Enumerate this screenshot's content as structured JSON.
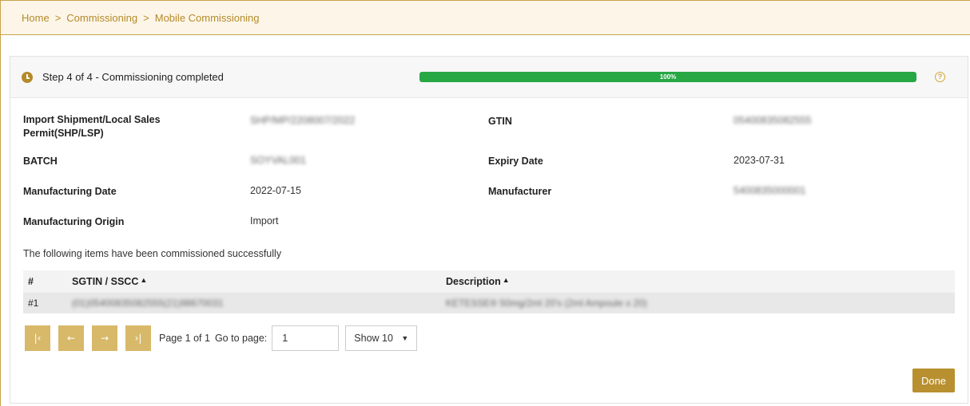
{
  "breadcrumb": {
    "items": [
      "Home",
      "Commissioning",
      "Mobile Commissioning"
    ],
    "separator": ">"
  },
  "step": {
    "title": "Step 4 of 4 - Commissioning completed",
    "progress_label": "100%",
    "progress_value": 1.0,
    "help_icon": "?"
  },
  "fields": {
    "import_permit_label": "Import Shipment/Local Sales Permit(SHP/LSP)",
    "import_permit_value": "SHP/MP/2208007/2022",
    "gtin_label": "GTIN",
    "gtin_value": "05400835082555",
    "batch_label": "BATCH",
    "batch_value": "SOYVAL001",
    "expiry_label": "Expiry Date",
    "expiry_value": "2023-07-31",
    "mfg_date_label": "Manufacturing Date",
    "mfg_date_value": "2022-07-15",
    "manufacturer_label": "Manufacturer",
    "manufacturer_value": "5400835000001",
    "origin_label": "Manufacturing Origin",
    "origin_value": "Import"
  },
  "info_text": "The following items have been commissioned successfully",
  "table": {
    "headers": {
      "num": "#",
      "sgtin": "SGTIN / SSCC",
      "desc": "Description",
      "sort_glyph": "▲"
    },
    "rows": [
      {
        "num": "#1",
        "sgtin": "(01)05400835082555(21)98670031",
        "desc": "KETESSE® 50mg/2ml 20's (2ml Ampoule x 20)"
      }
    ]
  },
  "pager": {
    "first": "|‹",
    "prev": "←",
    "next": "→",
    "last": "›|",
    "page_info": "Page 1 of 1",
    "goto_label": "Go to page:",
    "goto_value": "1",
    "show_label": "Show 10",
    "chevron": "⌄"
  },
  "actions": {
    "done_label": "Done"
  },
  "colors": {
    "accent": "#b58a2b",
    "progress": "#28a745",
    "pager_button": "#d8b869",
    "breadcrumb_bg": "#fdf6e8"
  }
}
